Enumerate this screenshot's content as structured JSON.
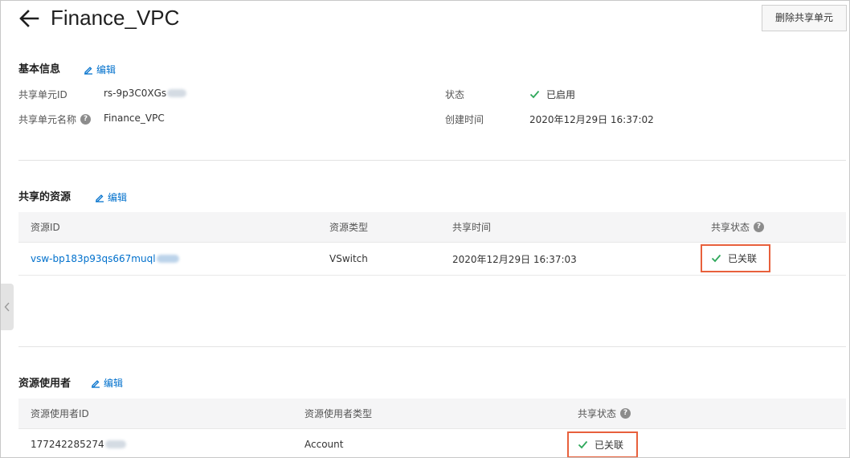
{
  "header": {
    "title": "Finance_VPC",
    "delete_button": "删除共享单元"
  },
  "basic_info": {
    "title": "基本信息",
    "edit": "编辑",
    "share_unit_id_label": "共享单元ID",
    "share_unit_id_value": "rs-9p3C0XGs",
    "share_unit_name_label": "共享单元名称",
    "share_unit_name_value": "Finance_VPC",
    "status_label": "状态",
    "status_value": "已启用",
    "created_label": "创建时间",
    "created_value": "2020年12月29日 16:37:02"
  },
  "shared_resources": {
    "title": "共享的资源",
    "edit": "编辑",
    "columns": [
      "资源ID",
      "资源类型",
      "共享时间",
      "共享状态"
    ],
    "rows": [
      {
        "resource_id": "vsw-bp183p93qs667muql",
        "type": "VSwitch",
        "shared_time": "2020年12月29日 16:37:03",
        "status": "已关联"
      }
    ]
  },
  "resource_users": {
    "title": "资源使用者",
    "edit": "编辑",
    "columns": [
      "资源使用者ID",
      "资源使用者类型",
      "共享状态"
    ],
    "rows": [
      {
        "user_id": "177242285274",
        "type": "Account",
        "status": "已关联"
      }
    ]
  },
  "colors": {
    "link": "#0070cc",
    "success": "#2fa85b",
    "highlight_box": "#e8603c"
  }
}
